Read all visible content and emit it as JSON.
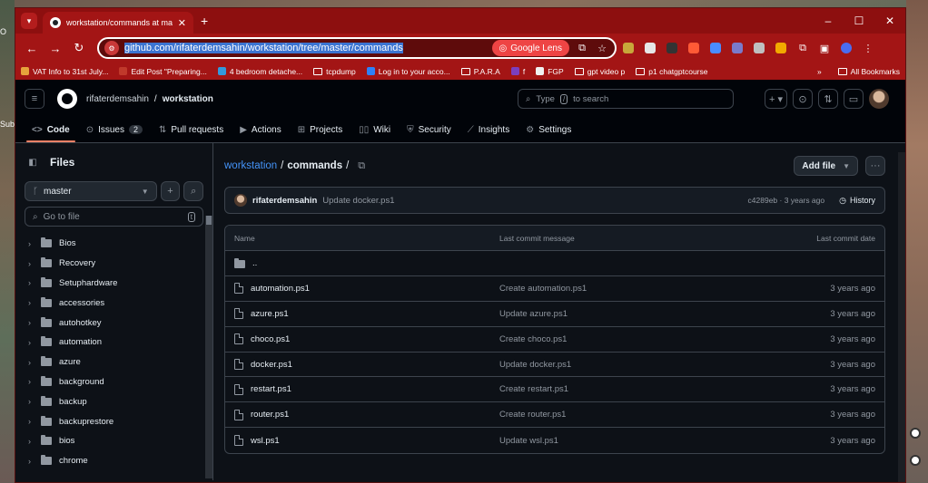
{
  "desktop": {
    "left_fragments": [
      "O",
      "Sub..."
    ]
  },
  "browser": {
    "tab_title": "workstation/commands at mas",
    "url_prefix": "github.com",
    "url_rest": "/rifaterdemsahin/workstation/tree/master/commands",
    "lens_label": "Google Lens",
    "bookmarks": [
      {
        "label": "VAT Info to 31st July...",
        "color": "#e6a23c"
      },
      {
        "label": "Edit Post \"Preparing...",
        "color": "#c0392b"
      },
      {
        "label": "4 bedroom detache...",
        "color": "#3498db"
      },
      {
        "label": "tcpdump",
        "folder": true
      },
      {
        "label": "Log in to your acco...",
        "color": "#2f81f7"
      },
      {
        "label": "P.A.R.A",
        "folder": true
      },
      {
        "label": "f",
        "color": "#7b3fbf"
      },
      {
        "label": "FGP",
        "color": "#f0f0f0"
      },
      {
        "label": "gpt video p",
        "folder": true
      },
      {
        "label": "p1 chatgptcourse",
        "folder": true
      }
    ],
    "bookmarks_more": "»",
    "all_bookmarks": "All Bookmarks"
  },
  "github": {
    "owner": "rifaterdemsahin",
    "separator": "/",
    "repo": "workstation",
    "search_placeholder_pre": "Type",
    "search_kbd": "/",
    "search_placeholder_post": "to search",
    "nav": [
      {
        "label": "Code",
        "icon": "<>",
        "active": true
      },
      {
        "label": "Issues",
        "icon": "⊙",
        "count": "2"
      },
      {
        "label": "Pull requests",
        "icon": "⇅"
      },
      {
        "label": "Actions",
        "icon": "▶"
      },
      {
        "label": "Projects",
        "icon": "⊞"
      },
      {
        "label": "Wiki",
        "icon": "📖"
      },
      {
        "label": "Security",
        "icon": "⛨"
      },
      {
        "label": "Insights",
        "icon": "📈"
      },
      {
        "label": "Settings",
        "icon": "⚙"
      }
    ]
  },
  "sidebar": {
    "title": "Files",
    "branch": "master",
    "goto_placeholder": "Go to file",
    "goto_kbd": "t",
    "tree": [
      "Bios",
      "Recovery",
      "Setuphardware",
      "accessories",
      "autohotkey",
      "automation",
      "azure",
      "background",
      "backup",
      "backuprestore",
      "bios",
      "chrome"
    ]
  },
  "main": {
    "repo_link": "workstation",
    "path_sep": "/",
    "current_dir": "commands",
    "path_trail": "/",
    "add_file": "Add file",
    "commit": {
      "author": "rifaterdemsahin",
      "message": "Update docker.ps1",
      "meta": "c4289eb · 3 years ago",
      "history": "History"
    },
    "table": {
      "headers": [
        "Name",
        "Last commit message",
        "Last commit date"
      ],
      "parent": "..",
      "rows": [
        {
          "name": "automation.ps1",
          "message": "Create automation.ps1",
          "date": "3 years ago"
        },
        {
          "name": "azure.ps1",
          "message": "Update azure.ps1",
          "date": "3 years ago"
        },
        {
          "name": "choco.ps1",
          "message": "Create choco.ps1",
          "date": "3 years ago"
        },
        {
          "name": "docker.ps1",
          "message": "Update docker.ps1",
          "date": "3 years ago"
        },
        {
          "name": "restart.ps1",
          "message": "Create restart.ps1",
          "date": "3 years ago"
        },
        {
          "name": "router.ps1",
          "message": "Create router.ps1",
          "date": "3 years ago"
        },
        {
          "name": "wsl.ps1",
          "message": "Update wsl.ps1",
          "date": "3 years ago"
        }
      ]
    }
  }
}
